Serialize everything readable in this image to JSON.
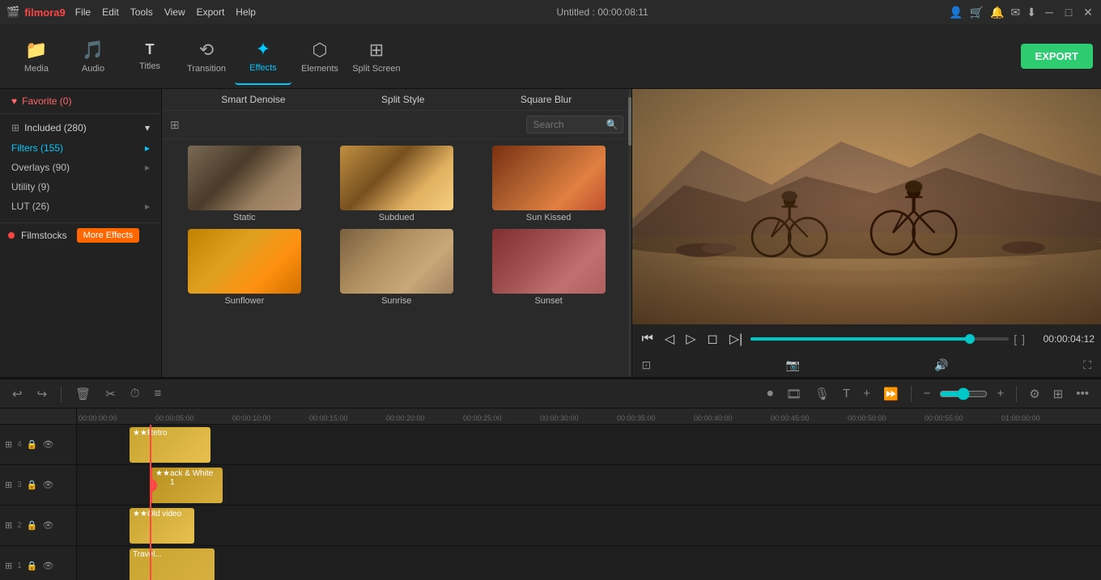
{
  "titlebar": {
    "logo": "🎬",
    "app_name": "filmora9",
    "menus": [
      "File",
      "Edit",
      "Tools",
      "View",
      "Export",
      "Help"
    ],
    "title": "Untitled : 00:00:08:11",
    "icons": [
      "user",
      "cart",
      "bell",
      "mail",
      "download",
      "minimize",
      "maximize",
      "close"
    ]
  },
  "toolbar": {
    "items": [
      {
        "id": "media",
        "icon": "📁",
        "label": "Media"
      },
      {
        "id": "audio",
        "icon": "🎵",
        "label": "Audio"
      },
      {
        "id": "titles",
        "icon": "T",
        "label": "Titles"
      },
      {
        "id": "transition",
        "icon": "⟲",
        "label": "Transition"
      },
      {
        "id": "effects",
        "icon": "✦",
        "label": "Effects"
      },
      {
        "id": "elements",
        "icon": "⬡",
        "label": "Elements"
      },
      {
        "id": "splitscreen",
        "icon": "⊞",
        "label": "Split Screen"
      }
    ],
    "export_label": "EXPORT"
  },
  "left_panel": {
    "favorite_label": "Favorite (0)",
    "sections": [
      {
        "id": "included",
        "label": "Included (280)",
        "has_arrow": true
      },
      {
        "id": "filters",
        "label": "Filters (155)",
        "active": true,
        "has_arrow": true
      },
      {
        "id": "overlays",
        "label": "Overlays (90)",
        "has_arrow": true
      },
      {
        "id": "utility",
        "label": "Utility (9)",
        "has_arrow": false
      },
      {
        "id": "lut",
        "label": "LUT (26)",
        "has_arrow": true
      }
    ],
    "filmstocks_label": "Filmstocks",
    "more_effects_label": "More Effects"
  },
  "effects_panel": {
    "top_labels": [
      "Smart Denoise",
      "Split Style",
      "Square Blur"
    ],
    "search_placeholder": "Search",
    "grid_icon": "⊞",
    "items": [
      {
        "id": "static",
        "label": "Static",
        "thumb_class": "thumb-static"
      },
      {
        "id": "subdued",
        "label": "Subdued",
        "thumb_class": "thumb-subdued"
      },
      {
        "id": "sunkissed",
        "label": "Sun Kissed",
        "thumb_class": "thumb-sunkissed"
      },
      {
        "id": "sunflower",
        "label": "Sunflower",
        "thumb_class": "thumb-sunflower"
      },
      {
        "id": "sunrise",
        "label": "Sunrise",
        "thumb_class": "thumb-sunrise"
      },
      {
        "id": "sunset",
        "label": "Sunset",
        "thumb_class": "thumb-sunset"
      }
    ]
  },
  "preview": {
    "timecode": "00:00:04:12",
    "progress_percent": 85,
    "time_marks": [
      "[",
      "]"
    ],
    "controls": [
      "skip-back",
      "prev-frame",
      "play",
      "stop",
      "next-frame",
      "skip-fwd"
    ]
  },
  "timeline": {
    "toolbar_buttons": [
      "undo",
      "redo",
      "delete",
      "cut",
      "timer",
      "adjust",
      "more"
    ],
    "right_buttons": [
      "record",
      "media",
      "audio",
      "title",
      "add",
      "speed",
      "minus",
      "slider",
      "plus",
      "settings",
      "grid",
      "dots"
    ],
    "ruler_marks": [
      "00:00:00:00",
      "00:00:05:00",
      "00:00:10:00",
      "00:00:15:00",
      "00:00:20:00",
      "00:00:25:00",
      "00:00:30:00",
      "00:00:35:00",
      "00:00:40:00",
      "00:00:45:00",
      "00:00:50:00",
      "00:00:55:00",
      "01:00:00:00"
    ],
    "tracks": [
      {
        "num": "4",
        "icons": [
          "grid",
          "lock",
          "eye"
        ]
      },
      {
        "num": "3",
        "icons": [
          "grid",
          "lock",
          "eye"
        ]
      },
      {
        "num": "2",
        "icons": [
          "grid",
          "lock",
          "eye"
        ]
      },
      {
        "num": "1",
        "icons": [
          "grid",
          "lock",
          "eye"
        ]
      }
    ],
    "clips": [
      {
        "id": "retro",
        "label": "Retro",
        "track": 0,
        "star": true
      },
      {
        "id": "bw1",
        "label": "ack & White 1",
        "track": 1,
        "star": true,
        "has_delete": true
      },
      {
        "id": "oldvideo",
        "label": "Old video",
        "track": 2,
        "star": true
      },
      {
        "id": "travel",
        "label": "Travel...",
        "track": 3,
        "star": false
      }
    ]
  }
}
